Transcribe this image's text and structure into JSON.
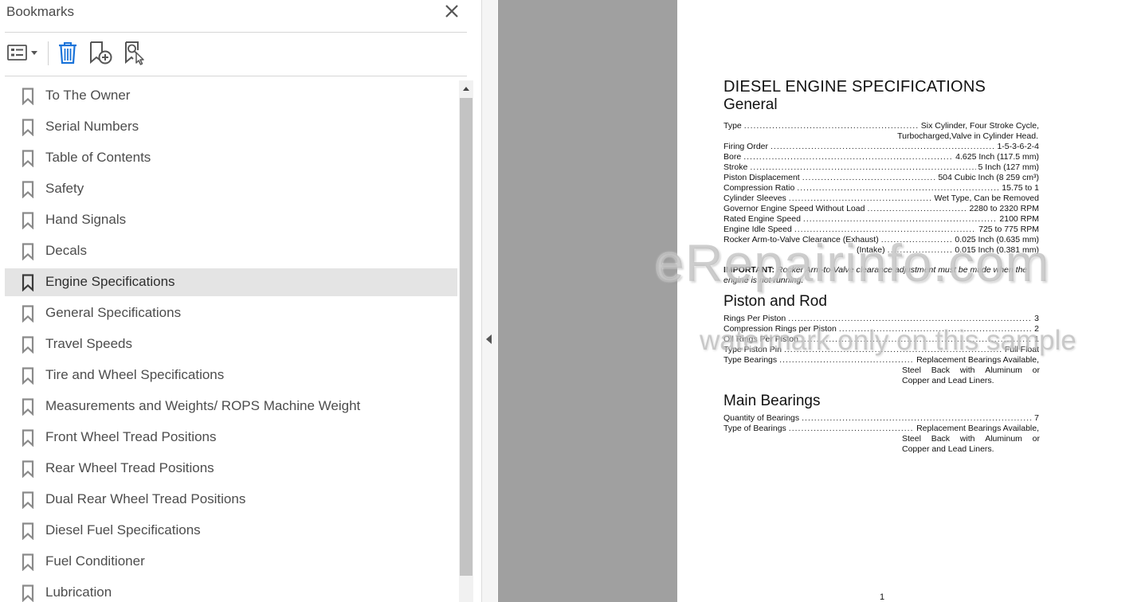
{
  "panel": {
    "title": "Bookmarks",
    "close_icon": "close-icon",
    "toolbar": {
      "options_icon": "bookmark-options-icon",
      "delete_icon": "trash-icon",
      "new_icon": "new-bookmark-icon",
      "find_icon": "find-current-bookmark-icon"
    }
  },
  "bookmarks": [
    {
      "label": "To The Owner",
      "selected": false
    },
    {
      "label": "Serial Numbers",
      "selected": false
    },
    {
      "label": "Table of Contents",
      "selected": false
    },
    {
      "label": "Safety",
      "selected": false
    },
    {
      "label": "Hand Signals",
      "selected": false
    },
    {
      "label": "Decals",
      "selected": false
    },
    {
      "label": "Engine Specifications",
      "selected": true
    },
    {
      "label": "General Specifications",
      "selected": false
    },
    {
      "label": "Travel Speeds",
      "selected": false
    },
    {
      "label": "Tire and Wheel Specifications",
      "selected": false
    },
    {
      "label": "Measurements and Weights/ ROPS Machine Weight",
      "selected": false
    },
    {
      "label": "Front Wheel Tread Positions",
      "selected": false
    },
    {
      "label": "Rear Wheel Tread Positions",
      "selected": false
    },
    {
      "label": "Dual Rear Wheel Tread Positions",
      "selected": false
    },
    {
      "label": "Diesel Fuel Specifications",
      "selected": false
    },
    {
      "label": "Fuel Conditioner",
      "selected": false
    },
    {
      "label": "Lubrication",
      "selected": false
    }
  ],
  "doc": {
    "title": "DIESEL ENGINE SPECIFICATIONS",
    "general": {
      "heading": "General",
      "type": {
        "key": "Type",
        "value": "Six Cylinder, Four Stroke Cycle,",
        "cont": "Turbocharged,Valve in Cylinder Head."
      },
      "firing": {
        "key": "Firing Order",
        "value": "1-5-3-6-2-4"
      },
      "bore": {
        "key": "Bore",
        "value": "4.625 Inch (117.5 mm)"
      },
      "stroke": {
        "key": "Stroke",
        "value": "5 Inch (127 mm)"
      },
      "displacement": {
        "key": "Piston Displacement",
        "value": "504 Cubic Inch (8 259 cm³)"
      },
      "compression": {
        "key": "Compression Ratio",
        "value": "15.75 to 1"
      },
      "sleeves": {
        "key": "Cylinder Sleeves",
        "value": "Wet Type, Can be Removed"
      },
      "governor": {
        "key": "Governor Engine Speed Without Load",
        "value": "2280 to 2320 RPM"
      },
      "rated": {
        "key": "Rated Engine Speed",
        "value": "2100 RPM"
      },
      "idle": {
        "key": "Engine Idle Speed",
        "value": "725 to 775 RPM"
      },
      "rocker": {
        "key": "Rocker Arm-to-Valve Clearance (Exhaust)",
        "value": "0.025 Inch (0.635 mm)"
      },
      "intake": {
        "key": "(Intake)",
        "value": "0.015 Inch (0.381 mm)"
      },
      "important_label": "IMPORTANT:",
      "important_text": "Rocker Arm-to-Valve clearance adjustment must be made when the engine is not running."
    },
    "piston": {
      "heading": "Piston and Rod",
      "rings": {
        "key": "Rings Per Piston",
        "value": "3"
      },
      "compression_rings": {
        "key": "Compression Rings per Piston",
        "value": "2"
      },
      "oil_rings": {
        "key": "Oil Rings Per Piston",
        "value": "1"
      },
      "pin": {
        "key": "Type Piston Pin",
        "value": "Full Float"
      },
      "bearings": {
        "key": "Type Bearings",
        "value": "Replacement Bearings Available,",
        "cont1": [
          "Steel",
          "Back",
          "with",
          "Aluminum",
          "or"
        ],
        "cont2": "Copper and Lead Liners."
      }
    },
    "main": {
      "heading": "Main Bearings",
      "quantity": {
        "key": "Quantity of Bearings",
        "value": "7"
      },
      "type": {
        "key": "Type of Bearings",
        "value": "Replacement Bearings Available,",
        "cont1": [
          "Steel",
          "Back",
          "with",
          "Aluminum",
          "or"
        ],
        "cont2": "Copper and Lead Liners."
      }
    },
    "page_number": "1"
  },
  "watermark": {
    "main": "eRepairinfo.com",
    "sub": "watermark only on this sample"
  },
  "colors": {
    "selected_row": "#e4e4e4",
    "gutter": "#a0a0a0",
    "icon": "#555555"
  }
}
